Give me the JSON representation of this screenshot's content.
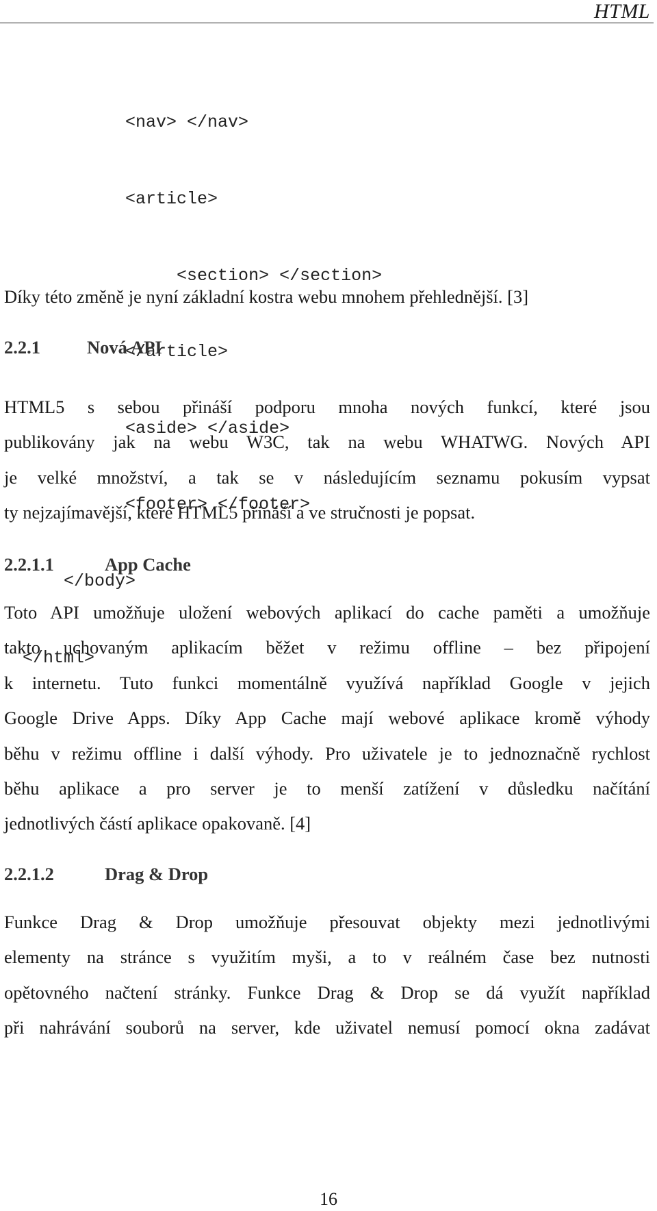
{
  "running_head": "HTML",
  "code_lines": [
    {
      "indent": "           ",
      "text": "<nav> </nav>"
    },
    {
      "indent": "           ",
      "text": "<article>"
    },
    {
      "indent": "                ",
      "text": "<section> </section>"
    },
    {
      "indent": "           ",
      "text": "</article>"
    },
    {
      "indent": "           ",
      "text": "<aside> </aside>"
    },
    {
      "indent": "           ",
      "text": "<footer> </footer>"
    },
    {
      "indent": "     ",
      "text": "</body>"
    },
    {
      "indent": " ",
      "text": "</html>"
    }
  ],
  "intro_paragraph": "Díky této změně je nyní základní kostra webu mnohem přehlednější. [3]",
  "section_221": {
    "number": "2.2.1",
    "title": "Nová API",
    "lines": [
      "HTML5 s sebou přináší podporu mnoha nových funkcí, které jsou",
      "publikovány jak na webu W3C, tak na webu WHATWG. Nových API",
      "je velké množství, a tak se v následujícím seznamu pokusím vypsat",
      "ty nejzajímavější, které HTML5 přináší a ve stručnosti je popsat."
    ]
  },
  "section_2211": {
    "number": "2.2.1.1",
    "title": "App Cache",
    "lines": [
      "Toto API umožňuje uložení webových aplikací do cache paměti a umožňuje",
      "takto uchovaným aplikacím běžet v režimu offline – bez připojení",
      "k internetu. Tuto funkci momentálně využívá například Google v jejich",
      "Google Drive Apps. Díky App Cache mají webové aplikace kromě výhody",
      "běhu v režimu offline i další výhody. Pro uživatele je to jednoznačně rychlost",
      "běhu aplikace a pro server je to menší zatížení v důsledku načítání",
      "jednotlivých částí aplikace opakovaně. [4]"
    ]
  },
  "section_2212": {
    "number": "2.2.1.2",
    "title": "Drag & Drop",
    "lines": [
      "Funkce Drag & Drop umožňuje přesouvat objekty mezi jednotlivými",
      "elementy na stránce s využitím myši, a to v reálném čase bez nutnosti",
      "opětovného načtení stránky. Funkce Drag & Drop se dá využít například",
      "při nahrávání souborů na server, kde uživatel nemusí pomocí okna zadávat"
    ]
  },
  "page_number": "16"
}
